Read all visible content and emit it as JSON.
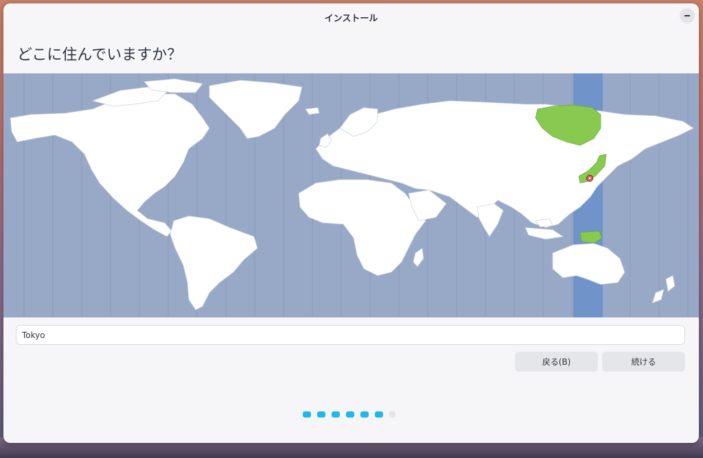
{
  "window": {
    "title": "インストール",
    "minimize_icon": "minimize-icon"
  },
  "page": {
    "heading": "どこに住んでいますか？"
  },
  "map": {
    "selected_timezone_highlight_color": "#7094c9",
    "selected_region_color": "#88c94f",
    "land_color": "#ffffff",
    "ocean_color": "#98a9c7",
    "pin_icon": "location-pin-icon",
    "selected_city": "Tokyo"
  },
  "timezone_field": {
    "value": "Tokyo"
  },
  "buttons": {
    "back_label": "戻る(B)",
    "continue_label": "続ける"
  },
  "progress": {
    "total_steps": 7,
    "completed_steps": 6,
    "active_color": "#1fb7ee",
    "inactive_color": "#e2e4e8"
  }
}
